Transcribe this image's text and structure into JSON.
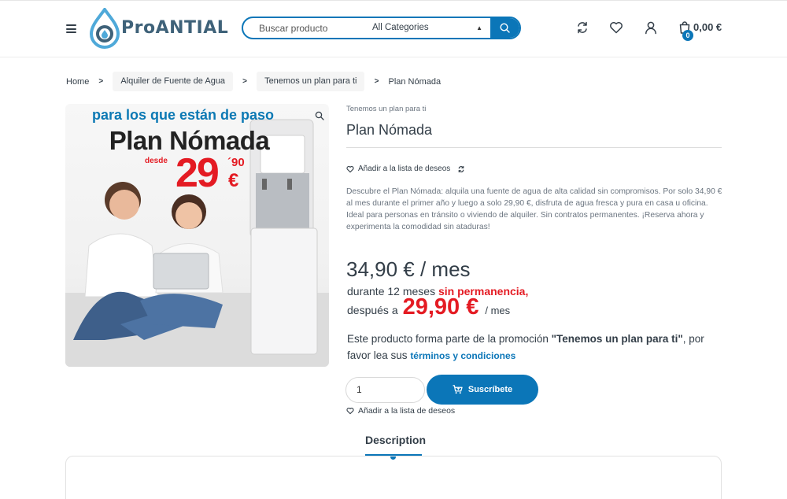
{
  "header": {
    "logo_text": "ProANTIAL",
    "search": {
      "placeholder": "Buscar producto",
      "category": "All Categories"
    },
    "cart": {
      "count": "0",
      "total": "0,00 €"
    }
  },
  "breadcrumb": [
    "Home",
    "Alquiler de Fuente de Agua",
    "Tenemos un plan para ti",
    "Plan Nómada"
  ],
  "image": {
    "tagline": "para los que están de paso",
    "title": "Plan Nómada",
    "desde": "desde",
    "price_int": "29",
    "price_cents": "´90",
    "currency": "€"
  },
  "product": {
    "category": "Tenemos un plan para ti",
    "title": "Plan Nómada",
    "wishlist_label": "Añadir a la lista de deseos",
    "description": "Descubre el Plan Nómada: alquila una fuente de agua de alta calidad sin compromisos. Por solo 34,90 € al mes durante el primer año y luego a solo 29,90 €, disfruta de agua fresca y pura en casa u oficina. Ideal para personas en tránsito o viviendo de alquiler. Sin contratos permanentes. ¡Reserva ahora y experimenta la comodidad sin ataduras!",
    "price_main": "34,90 € / mes",
    "price_line2_text": "durante 12 meses",
    "price_line2_red": "sin permanencia,",
    "price_line3_prefix": "después a",
    "price_line3_big": "29,90 €",
    "price_line3_suffix": "/ mes",
    "promo_prefix": "Este producto forma parte de la promoción",
    "promo_name": "\"Tenemos un plan para ti\"",
    "promo_mid": ", por favor lea sus",
    "promo_link": "términos y condiciones",
    "quantity": "1",
    "subscribe_label": "Suscríbete"
  },
  "tabs": {
    "description": "Description"
  },
  "colors": {
    "accent": "#0b76b8",
    "red": "#e41b23",
    "text": "#333e48"
  }
}
